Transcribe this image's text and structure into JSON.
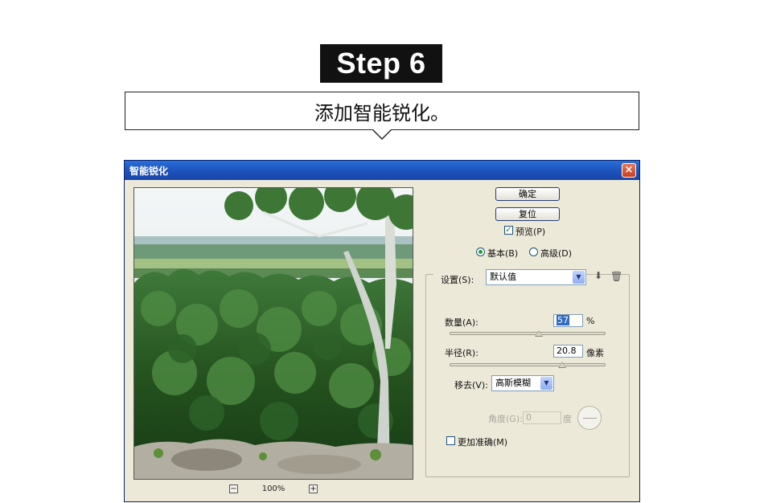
{
  "tutorial": {
    "step": "Step 6",
    "caption": "添加智能锐化。"
  },
  "dialog": {
    "title": "智能锐化",
    "close_glyph": "×",
    "buttons": {
      "ok": "确定",
      "reset": "复位"
    },
    "preview_checkbox": {
      "label": "预览(P)",
      "checked": true
    },
    "mode": {
      "basic": {
        "label": "基本(B)",
        "selected": true
      },
      "advanced": {
        "label": "高级(D)",
        "selected": false
      }
    },
    "settings": {
      "label": "设置(S):",
      "value": "默认值"
    },
    "amount": {
      "label": "数量(A):",
      "value": "57",
      "unit": "%",
      "slider_fraction": 0.57
    },
    "radius": {
      "label": "半径(R):",
      "value": "20.8",
      "unit": "像素",
      "slider_fraction": 0.72
    },
    "remove": {
      "label": "移去(V):",
      "value": "高斯模糊"
    },
    "angle": {
      "label": "角度(G):",
      "value": "0",
      "unit": "度"
    },
    "more_accurate": {
      "label": "更加准确(M)",
      "checked": false
    },
    "zoom": {
      "minus": "−",
      "level": "100%",
      "plus": "+"
    }
  }
}
